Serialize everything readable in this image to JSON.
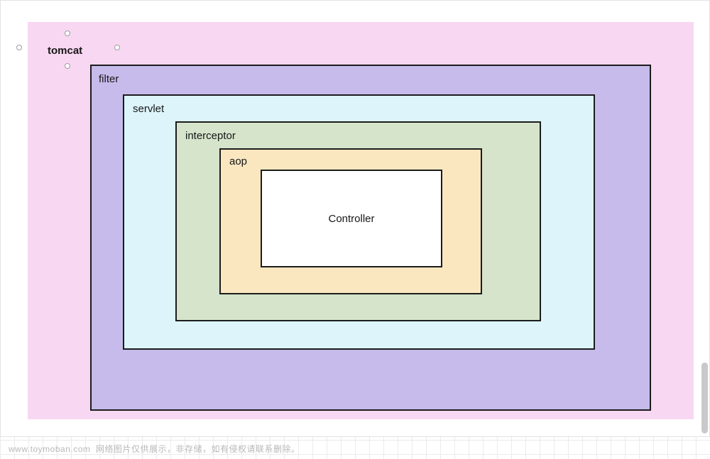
{
  "diagram": {
    "tomcat": {
      "label": "tomcat"
    },
    "filter": {
      "label": "filter"
    },
    "servlet": {
      "label": "servlet"
    },
    "interceptor": {
      "label": "interceptor"
    },
    "aop": {
      "label": "aop"
    },
    "controller": {
      "label": "Controller"
    }
  },
  "watermark": {
    "site": "www.toymoban.com",
    "note": "网络图片仅供展示，非存储，如有侵权请联系删除。"
  }
}
